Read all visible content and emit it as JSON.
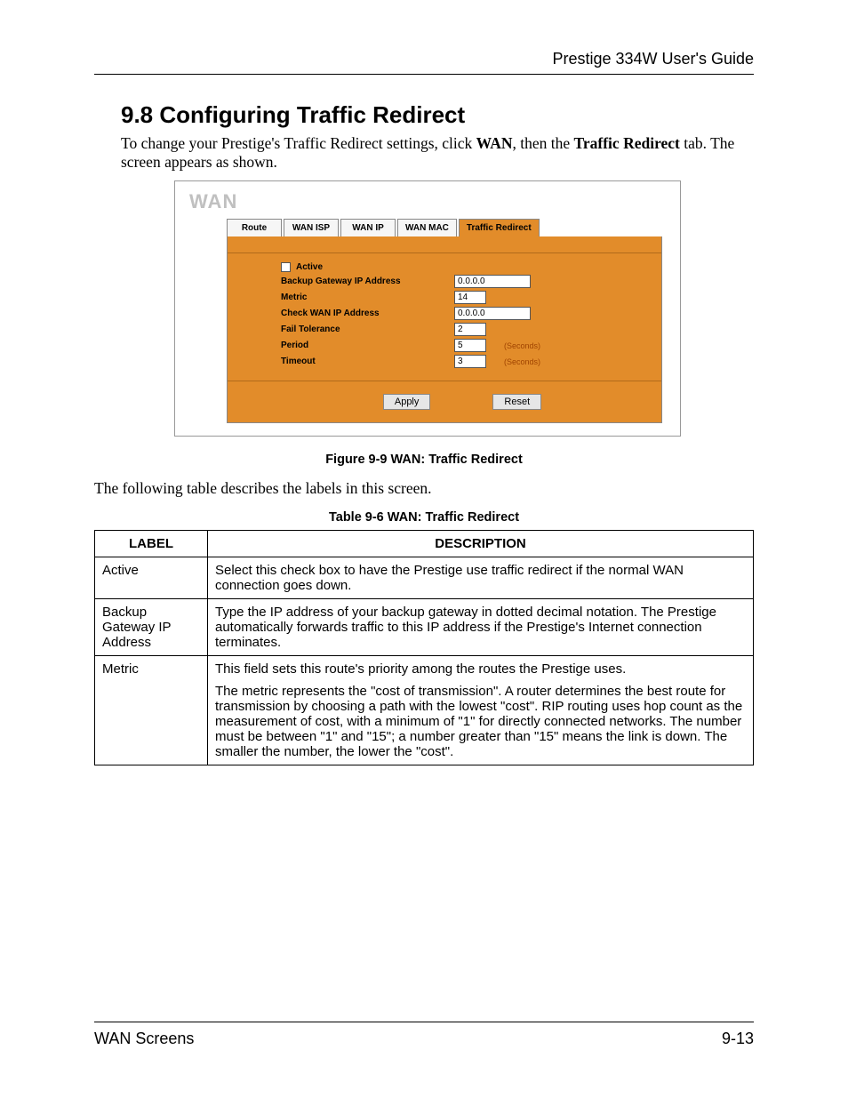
{
  "header": {
    "guide_title": "Prestige 334W User's Guide"
  },
  "section": {
    "number_title": "9.8   Configuring Traffic Redirect",
    "intro_pre": "To change your Prestige's Traffic Redirect settings, click ",
    "intro_b1": "WAN",
    "intro_mid": ", then the ",
    "intro_b2": "Traffic Redirect",
    "intro_post": " tab.  The screen appears as shown."
  },
  "screenshot": {
    "title": "WAN",
    "tabs": [
      "Route",
      "WAN ISP",
      "WAN IP",
      "WAN MAC",
      "Traffic Redirect"
    ],
    "active_tab_index": 4,
    "fields": {
      "active_label": "Active",
      "backup_gateway_label": "Backup Gateway IP Address",
      "backup_gateway_value": "0.0.0.0",
      "metric_label": "Metric",
      "metric_value": "14",
      "check_wan_label": "Check WAN IP Address",
      "check_wan_value": "0.0.0.0",
      "fail_tol_label": "Fail Tolerance",
      "fail_tol_value": "2",
      "period_label": "Period",
      "period_value": "5",
      "timeout_label": "Timeout",
      "timeout_value": "3",
      "seconds_unit": "(Seconds)"
    },
    "buttons": {
      "apply": "Apply",
      "reset": "Reset"
    }
  },
  "figure_caption": "Figure 9-9 WAN: Traffic Redirect",
  "table_intro": "The following table describes the labels in this screen.",
  "table_caption": "Table 9-6 WAN: Traffic Redirect",
  "table": {
    "col_label": "LABEL",
    "col_desc": "DESCRIPTION",
    "rows": [
      {
        "label": "Active",
        "desc": "Select this check box to have the Prestige use traffic redirect if the normal WAN connection goes down."
      },
      {
        "label": "Backup Gateway IP Address",
        "desc": "Type the IP address of your backup gateway in dotted decimal notation. The Prestige automatically forwards traffic to this IP address if the Prestige's Internet connection terminates."
      },
      {
        "label": "Metric",
        "desc1": "This field sets this route's priority among the routes the Prestige uses.",
        "desc2": "The metric represents the \"cost of transmission\". A router determines the best route for transmission by choosing a path with the lowest \"cost\". RIP routing uses hop count as the measurement of cost, with a minimum of \"1\" for directly connected networks. The number must be between \"1\" and \"15\"; a number greater than \"15\" means the link is down. The smaller the number, the lower the \"cost\"."
      }
    ]
  },
  "footer": {
    "left": "WAN Screens",
    "right": "9-13"
  }
}
